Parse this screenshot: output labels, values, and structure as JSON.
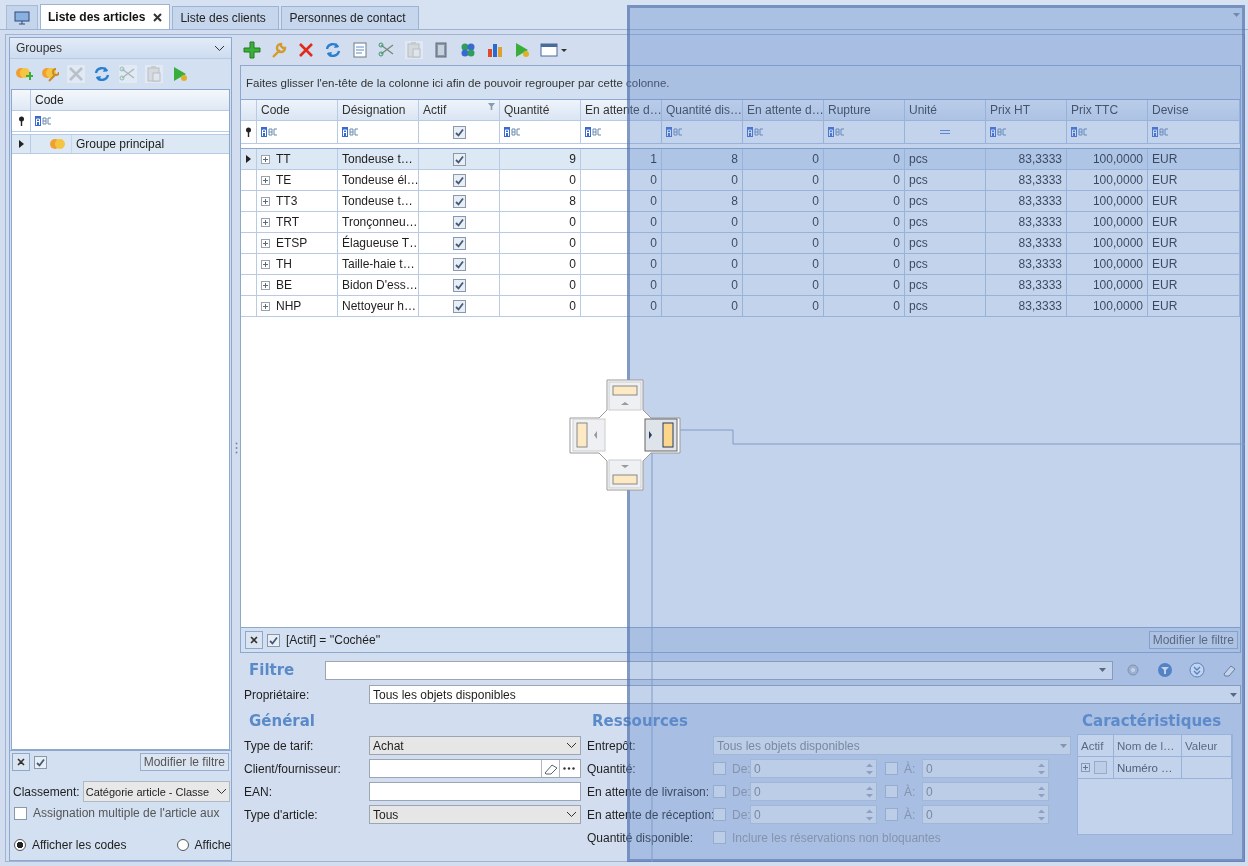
{
  "tabs": [
    {
      "label": "Liste des articles",
      "selected": true,
      "closable": true
    },
    {
      "label": "Liste des clients",
      "selected": false,
      "closable": false
    },
    {
      "label": "Personnes de contact",
      "selected": false,
      "closable": false
    }
  ],
  "groups_panel": {
    "title": "Groupes",
    "toolbar": [
      {
        "disabled": false
      },
      {
        "disabled": false
      },
      {
        "disabled": true
      },
      {
        "disabled": false
      },
      {
        "disabled": true
      },
      {
        "disabled": true
      },
      {
        "disabled": false
      }
    ],
    "columns": [
      "Code"
    ],
    "rows": [
      {
        "label": "Groupe principal",
        "selected": true
      }
    ],
    "filter_bar": {
      "enabled": true,
      "button": "Modifier le filtre"
    },
    "classement": {
      "label": "Classement:",
      "value": "Catégorie article - Classe"
    },
    "multi_assign": {
      "label": "Assignation multiple de l'article aux",
      "checked": false
    },
    "display_options": [
      {
        "label": "Afficher les codes",
        "selected": true
      },
      {
        "label": "Affiche",
        "selected": false
      }
    ]
  },
  "toolbar": [
    {
      "disabled": false
    },
    {
      "disabled": false
    },
    {
      "disabled": false
    },
    {
      "disabled": false
    },
    {
      "disabled": false
    },
    {
      "disabled": false
    },
    {
      "disabled": true
    },
    {
      "disabled": false
    },
    {
      "disabled": false
    },
    {
      "disabled": false
    },
    {
      "disabled": false
    },
    {
      "disabled": false
    }
  ],
  "grid": {
    "group_hint": "Faites glisser l'en-tête de la colonne ici afin de pouvoir regrouper par cette colonne.",
    "columns": [
      {
        "label": "Code",
        "kind": "code",
        "filter": {
          "kind": "text"
        }
      },
      {
        "label": "Désignation",
        "kind": "text",
        "filter": {
          "kind": "text"
        }
      },
      {
        "label": "Actif",
        "kind": "check",
        "filter": {
          "kind": "check",
          "checked": true
        },
        "filtered": true
      },
      {
        "label": "Quantité",
        "kind": "number",
        "filter": {
          "kind": "text"
        }
      },
      {
        "label": "En attente d…",
        "kind": "number",
        "filter": {
          "kind": "text"
        }
      },
      {
        "label": "Quantité dis…",
        "kind": "number",
        "filter": {
          "kind": "text"
        }
      },
      {
        "label": "En attente d…",
        "kind": "number",
        "filter": {
          "kind": "text"
        }
      },
      {
        "label": "Rupture",
        "kind": "number",
        "filter": {
          "kind": "text"
        }
      },
      {
        "label": "Unité",
        "kind": "text",
        "filter": {
          "kind": "equals"
        }
      },
      {
        "label": "Prix HT",
        "kind": "number",
        "filter": {
          "kind": "text"
        }
      },
      {
        "label": "Prix TTC",
        "kind": "number",
        "filter": {
          "kind": "text"
        }
      },
      {
        "label": "Devise",
        "kind": "text",
        "filter": {
          "kind": "text"
        }
      }
    ],
    "rows": [
      {
        "selected": true,
        "cells": [
          "TT",
          "Tondeuse t…",
          true,
          "9",
          "1",
          "8",
          "0",
          "0",
          "pcs",
          "83,3333",
          "100,0000",
          "EUR"
        ]
      },
      {
        "selected": false,
        "cells": [
          "TE",
          "Tondeuse él…",
          true,
          "0",
          "0",
          "0",
          "0",
          "0",
          "pcs",
          "83,3333",
          "100,0000",
          "EUR"
        ]
      },
      {
        "selected": false,
        "cells": [
          "TT3",
          "Tondeuse t…",
          true,
          "8",
          "0",
          "8",
          "0",
          "0",
          "pcs",
          "83,3333",
          "100,0000",
          "EUR"
        ]
      },
      {
        "selected": false,
        "cells": [
          "TRT",
          "Tronçonneu…",
          true,
          "0",
          "0",
          "0",
          "0",
          "0",
          "pcs",
          "83,3333",
          "100,0000",
          "EUR"
        ]
      },
      {
        "selected": false,
        "cells": [
          "ETSP",
          "Élagueuse T…",
          true,
          "0",
          "0",
          "0",
          "0",
          "0",
          "pcs",
          "83,3333",
          "100,0000",
          "EUR"
        ]
      },
      {
        "selected": false,
        "cells": [
          "TH",
          "Taille-haie t…",
          true,
          "0",
          "0",
          "0",
          "0",
          "0",
          "pcs",
          "83,3333",
          "100,0000",
          "EUR"
        ]
      },
      {
        "selected": false,
        "cells": [
          "BE",
          "Bidon D'ess…",
          true,
          "0",
          "0",
          "0",
          "0",
          "0",
          "pcs",
          "83,3333",
          "100,0000",
          "EUR"
        ]
      },
      {
        "selected": false,
        "cells": [
          "NHP",
          "Nettoyeur h…",
          true,
          "0",
          "0",
          "0",
          "0",
          "0",
          "pcs",
          "83,3333",
          "100,0000",
          "EUR"
        ]
      }
    ],
    "filter_bar": {
      "enabled": true,
      "expression": "[Actif] = ''Cochée''",
      "button": "Modifier le filtre"
    }
  },
  "filter_form": {
    "title": "Filtre",
    "owner": {
      "label": "Propriétaire:",
      "value": "Tous les objets disponibles"
    },
    "general": {
      "title": "Général",
      "fields": [
        {
          "kind": "combo",
          "label": "Type de tarif:",
          "value": "Achat"
        },
        {
          "kind": "lookup",
          "label": "Client/fournisseur:"
        },
        {
          "kind": "text",
          "label": "EAN:"
        },
        {
          "kind": "combo",
          "label": "Type d'article:",
          "value": "Tous"
        }
      ]
    },
    "resources": {
      "title": "Ressources",
      "warehouse": {
        "label": "Entrepôt:",
        "value": "Tous les objets disponibles"
      },
      "ranges": [
        {
          "label": "Quantité:",
          "from_label": "De:",
          "from": "0",
          "to_label": "À:",
          "to": "0",
          "from_checked": false,
          "to_checked": false
        },
        {
          "label": "En attente de livraison:",
          "from_label": "De:",
          "from": "0",
          "to_label": "À:",
          "to": "0",
          "from_checked": false,
          "to_checked": false
        },
        {
          "label": "En attente de réception:",
          "from_label": "De:",
          "from": "0",
          "to_label": "À:",
          "to": "0",
          "from_checked": false,
          "to_checked": false
        }
      ],
      "available": {
        "label": "Quantité disponible:",
        "option": "Inclure les réservations non bloquantes",
        "checked": false
      }
    },
    "characteristics": {
      "title": "Caractéristiques",
      "columns": [
        "Actif",
        "Nom de l…",
        "Valeur"
      ],
      "rows": [
        {
          "active": false,
          "name": "Numéro …"
        }
      ]
    }
  }
}
